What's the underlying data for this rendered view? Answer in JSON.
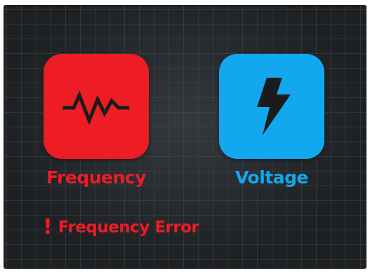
{
  "colors": {
    "frequency": "#ee1c24",
    "voltage": "#12a8ef",
    "background": "#1e2022",
    "icon_dark": "#1b1b1b"
  },
  "tiles": [
    {
      "label": "Frequency",
      "icon": "waveform-icon"
    },
    {
      "label": "Voltage",
      "icon": "lightning-bolt-icon"
    }
  ],
  "alert": {
    "icon": "exclamation-icon",
    "symbol": "!",
    "message": "Frequency Error"
  }
}
